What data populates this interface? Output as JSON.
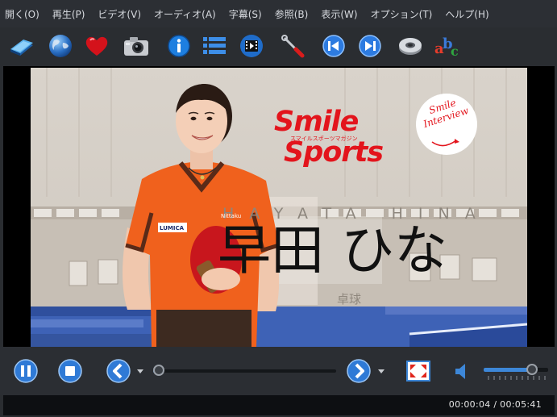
{
  "menu": [
    "開く(O)",
    "再生(P)",
    "ビデオ(V)",
    "オーディオ(A)",
    "字幕(S)",
    "参照(B)",
    "表示(W)",
    "オプション(T)",
    "ヘルプ(H)"
  ],
  "toolbar_icons": [
    "open-book-icon",
    "globe-icon",
    "heart-icon",
    "camera-icon",
    "info-icon",
    "list-icon",
    "film-icon",
    "tools-icon",
    "previous-icon",
    "next-icon",
    "disc-icon",
    "abc-icon"
  ],
  "video": {
    "brand_line1": "Smile",
    "brand_line2": "Sports",
    "brand_sub": "スマイルスポーツマガジン",
    "badge_line1": "Smile",
    "badge_line2": "Interview",
    "name_romaji": "HAYATA HINA",
    "name_kanji": "早田 ひな",
    "sport": "卓球",
    "shirt_text": "Nittaku",
    "shirt_sponsor": "LUMICA"
  },
  "playback": {
    "progress": 0.0122,
    "volume": 0.75,
    "time_text": "00:00:04 / 00:05:41"
  },
  "colors": {
    "accent": "#3d87d8",
    "brand_red": "#e3141c",
    "shirt_orange": "#f0611d"
  }
}
